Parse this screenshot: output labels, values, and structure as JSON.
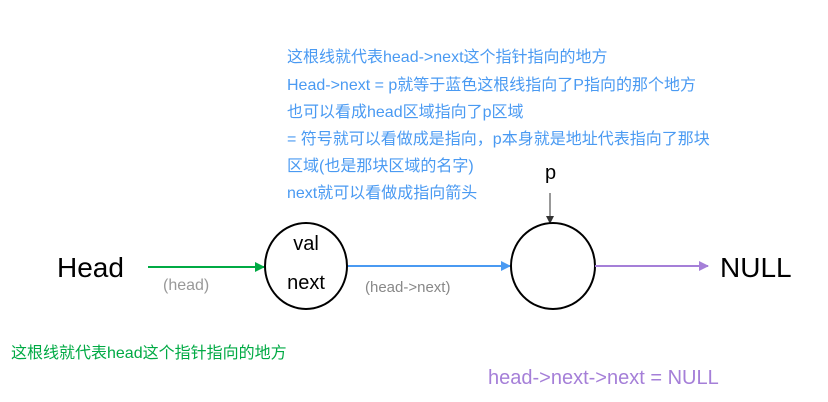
{
  "colors": {
    "green": "#00aa44",
    "blue": "#4a9af2",
    "purple": "#a57fd8",
    "label_gray": "#999999"
  },
  "annotation_blue": [
    "这根线就代表head->next这个指针指向的地方",
    "Head->next = p就等于蓝色这根线指向了P指向的那个地方",
    "也可以看成head区域指向了p区域",
    "= 符号就可以看做成是指向，p本身就是地址代表指向了那块",
    "区域(也是那块区域的名字)",
    "next就可以看做成指向箭头"
  ],
  "nodes": {
    "head_label": "Head",
    "node1_val": "val",
    "node1_next": "next",
    "p_label": "p",
    "null_label": "NULL"
  },
  "edges": {
    "head_edge_label": "(head)",
    "next_edge_label": "(head->next)"
  },
  "annotation_green": "这根线就代表head这个指针指向的地方",
  "annotation_purple": "head->next->next = NULL"
}
